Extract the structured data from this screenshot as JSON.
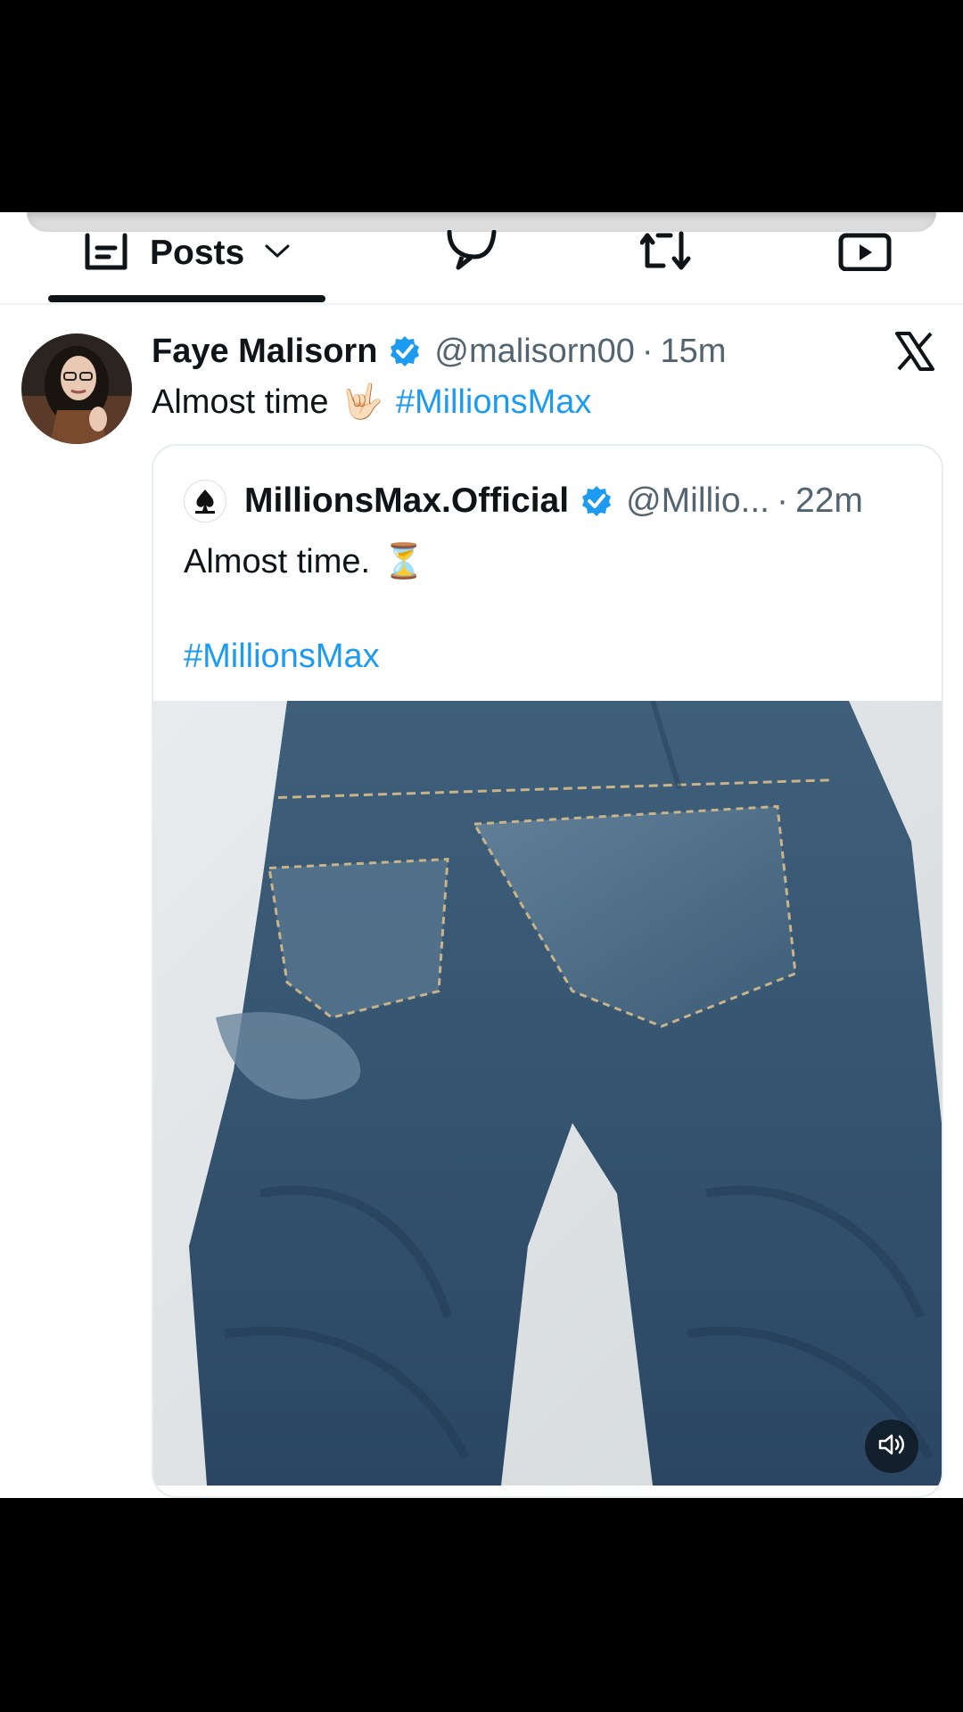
{
  "tabs": {
    "posts_label": "Posts"
  },
  "post": {
    "author_name": "Faye Malisorn",
    "handle": "@malisorn00",
    "separator": "·",
    "time": "15m",
    "text": "Almost time",
    "emoji": "🤟🏻",
    "hashtag": "#MillionsMax",
    "quote": {
      "author_name": "MillionsMax.Official",
      "handle": "@Millio...",
      "separator": "·",
      "time": "22m",
      "line1_text": "Almost time.",
      "line1_emoji": "⏳",
      "line2_hashtag": "#MillionsMax"
    }
  },
  "colors": {
    "accent": "#1d9bf0",
    "text_primary": "#0f1419",
    "text_secondary": "#536471",
    "verified": "#1d9bf0"
  },
  "icons": [
    "posts-icon",
    "chevron-down-icon",
    "replies-icon",
    "reposts-icon",
    "media-icon",
    "x-logo-icon",
    "verified-badge-icon",
    "volume-icon"
  ]
}
